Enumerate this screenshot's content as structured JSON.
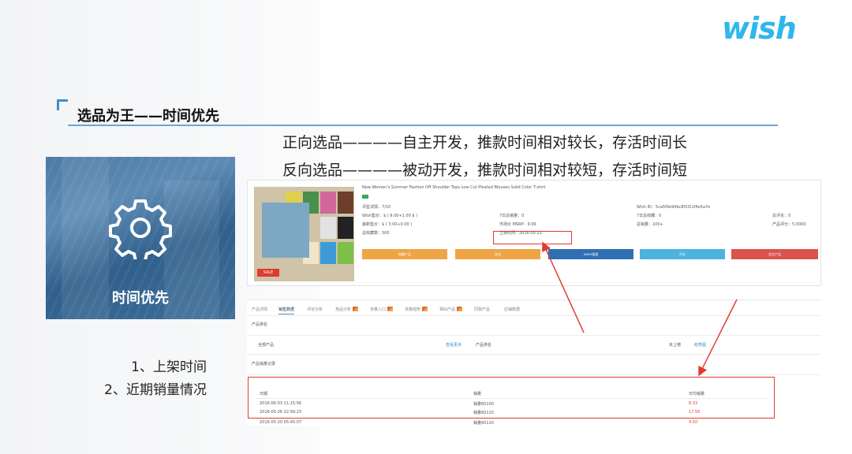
{
  "logo_text": "wish",
  "section_title": "选品为王——时间优先",
  "lines": {
    "forward": "正向选品————自主开发，推款时间相对较长，存活时间长",
    "reverse": "反向选品————被动开发，推款时间相对较短，存活时间短"
  },
  "tile": {
    "label": "时间优先",
    "icon": "gear-icon"
  },
  "bottom_list": [
    "1、上架时间",
    "2、近期销量情况"
  ],
  "product": {
    "title": "New Women's Summer Fashion Off Shoulder Tops Low Cut Pleated Blouses Solid Color T-shirt",
    "sale_label": "SALE",
    "fields": {
      "r1c1": "评星详情：7/10",
      "r1c3": "Wish ID：5ca5f0e94bc8f1f21f4e5a7e",
      "r2c1": "Wish售价：$ ( 9.00+1.00 $ )",
      "r2c2": "7日总销量：0",
      "r2c3": "7日总收藏：0",
      "r2c4": "总评论：0",
      "r3c1": "最新售价：$ ( 3.00+0.00 )",
      "r3c2": "市场价 MSRP：9.99",
      "r3c3": "总销量：100+",
      "r3c4": "产品评分：5.0000",
      "r4c1": "总收藏数：500",
      "r4c2": "上架时间：2016-05-21"
    },
    "buttons": [
      {
        "label": "收藏产品",
        "color": "#efa445"
      },
      {
        "label": "关注",
        "color": "#efa445"
      },
      {
        "label": "WISH链接",
        "color": "#2f6fb3"
      },
      {
        "label": "评论",
        "color": "#4bb3de"
      },
      {
        "label": "关注产品",
        "color": "#d9534f"
      }
    ]
  },
  "tabpanel": {
    "tabs": [
      "产品详情",
      "销售数据",
      "评论分析",
      "竞品分析",
      "流量入口",
      "流量趋势",
      "相似产品",
      "同款产品",
      "店铺数据"
    ],
    "active_tab": 1,
    "section1": "产品排名",
    "row_label": "全部产品",
    "row_link": "查看更多",
    "row_col2": "产品排名",
    "row_col3": "未上榜",
    "row_col4": "趋势图",
    "section2": "产品销量记录",
    "table_headers": [
      "日期",
      "销量",
      "日均销量"
    ],
    "rows": [
      [
        "2016-06-03 11:15:56",
        "销量60100",
        "8.33"
      ],
      [
        "2016-05-26 22:56:23",
        "销量60110",
        "17.55"
      ],
      [
        "2016-05-20 05:45:07",
        "销量60110",
        "4.50"
      ]
    ]
  }
}
